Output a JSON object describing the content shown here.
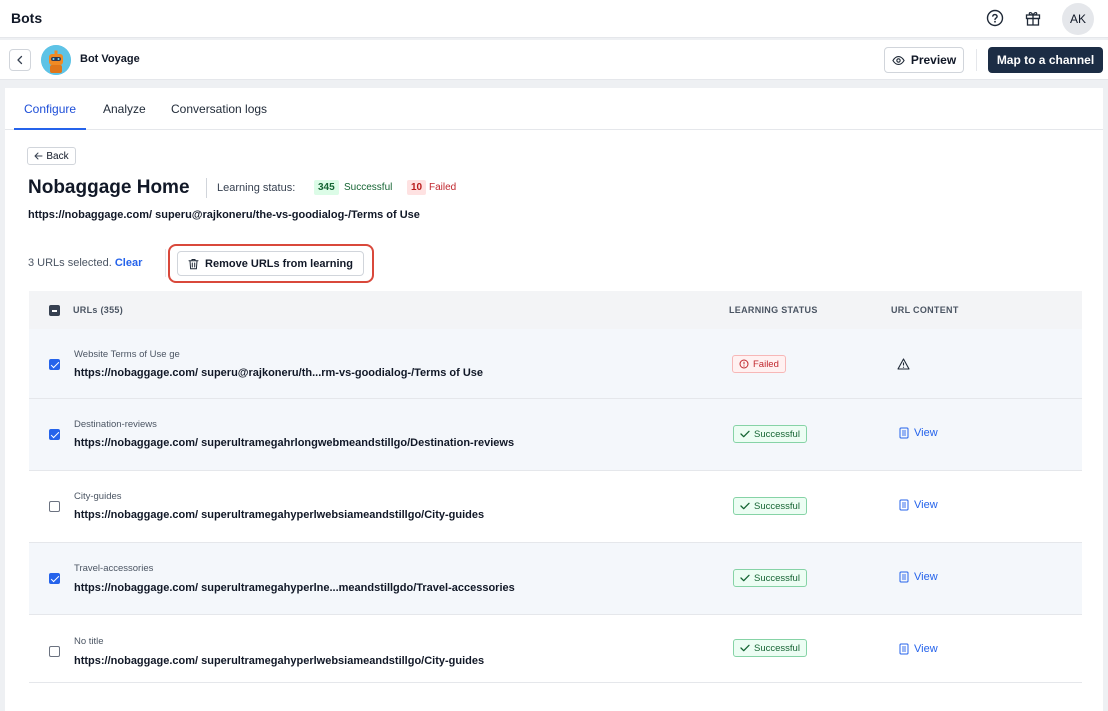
{
  "app": {
    "title": "Bots",
    "user_initials": "AK"
  },
  "icons": {
    "help": "help-circle-icon",
    "gift": "gift-icon",
    "back": "chevron-left-icon",
    "eye": "eye-icon",
    "trash": "trash-icon",
    "warning": "warning-triangle-icon",
    "document": "document-icon",
    "check": "check-icon",
    "alert": "alert-circle-icon"
  },
  "bot": {
    "name": "Bot Voyage"
  },
  "header_actions": {
    "preview_label": "Preview",
    "map_label": "Map to a channel"
  },
  "tabs": [
    {
      "label": "Configure",
      "active": true
    },
    {
      "label": "Analyze",
      "active": false
    },
    {
      "label": "Conversation logs",
      "active": false
    }
  ],
  "back_label": "Back",
  "page": {
    "title": "Nobaggage Home",
    "learning_status_label": "Learning status:",
    "success_count": "345",
    "success_label": "Successful",
    "failed_count": "10",
    "failed_label": "Failed",
    "url": "https://nobaggage.com/ superu@rajkoneru/the-vs-goodialog-/Terms of Use"
  },
  "selection": {
    "text": "3 URLs selected.",
    "clear_label": "Clear",
    "remove_label": "Remove URLs from learning"
  },
  "table": {
    "headers": {
      "urls": "URLs (355)",
      "learning_status": "LEARNING STATUS",
      "url_content": "URL CONTENT"
    },
    "rows": [
      {
        "title": "Website Terms of Use ge",
        "url": "https://nobaggage.com/ superu@rajkoneru/th...rm-vs-goodialog-/Terms of Use",
        "checked": true,
        "status": "Failed",
        "content": "warning"
      },
      {
        "title": "Destination-reviews",
        "url": "https://nobaggage.com/ superultramegahrlongwebmeandstillgo/Destination-reviews",
        "checked": true,
        "status": "Successful",
        "content": "View"
      },
      {
        "title": "City-guides",
        "url": "https://nobaggage.com/ superultramegahyperlwebsiameandstillgo/City-guides",
        "checked": false,
        "status": "Successful",
        "content": "View"
      },
      {
        "title": "Travel-accessories",
        "url": "https://nobaggage.com/ superultramegahyperlne...meandstillgdo/Travel-accessories",
        "checked": true,
        "status": "Successful",
        "content": "View"
      },
      {
        "title": "No title",
        "url": "https://nobaggage.com/ superultramegahyperlwebsiameandstillgo/City-guides",
        "checked": false,
        "status": "Successful",
        "content": "View"
      }
    ]
  },
  "colors": {
    "accent": "#2563eb",
    "primary_button": "#1c2d45",
    "success": "#166534",
    "failed": "#c0262d",
    "highlight": "#d9483b"
  }
}
